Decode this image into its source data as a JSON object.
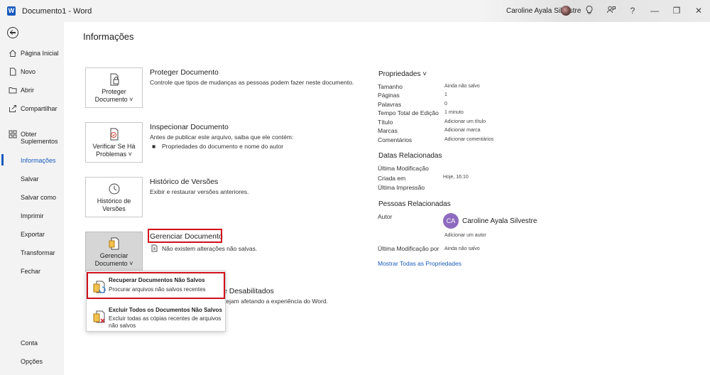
{
  "titlebar": {
    "app_icon": "W",
    "doc_title": "Documento1  -  Word",
    "user_name": "Caroline Ayala Silvestre",
    "icons": [
      "lightbulb-icon",
      "people-icon",
      "help-icon",
      "minimize-icon",
      "restore-icon",
      "close-icon"
    ],
    "help_glyph": "?",
    "minimize_glyph": "—",
    "restore_glyph": "❐",
    "close_glyph": "✕",
    "bulb_glyph": "💡",
    "people_glyph": "⚑"
  },
  "sidebar": {
    "items": [
      {
        "label": "Página Inicial",
        "icon": "home-icon"
      },
      {
        "label": "Novo",
        "icon": "new-doc-icon"
      },
      {
        "label": "Abrir",
        "icon": "folder-icon"
      },
      {
        "label": "Compartilhar",
        "icon": "share-icon"
      },
      {
        "label": "Obter",
        "label2": "Suplementos",
        "icon": "addins-icon"
      },
      {
        "label": "Informações",
        "active": true
      },
      {
        "label": "Salvar"
      },
      {
        "label": "Salvar como"
      },
      {
        "label": "Imprimir"
      },
      {
        "label": "Exportar"
      },
      {
        "label": "Transformar"
      },
      {
        "label": "Fechar"
      }
    ],
    "footer": [
      {
        "label": "Conta"
      },
      {
        "label": "Opções"
      }
    ]
  },
  "main": {
    "title": "Informações",
    "sections": [
      {
        "button_line1": "Proteger",
        "button_line2": "Documento ˅",
        "title": "Proteger Documento",
        "desc": "Controle que tipos de mudanças as pessoas podem fazer neste documento."
      },
      {
        "button_line1": "Verificar Se Há",
        "button_line2": "Problemas ˅",
        "title": "Inspecionar Documento",
        "desc": "Antes de publicar este arquivo, saiba que ele contém:",
        "bullet": "Propriedades do documento e nome do autor"
      },
      {
        "button_line1": "Histórico de",
        "button_line2": "Versões",
        "title": "Histórico de Versões",
        "desc": "Exibir e restaurar versões anteriores."
      },
      {
        "button_line1": "Gerenciar",
        "button_line2": "Documento ˅",
        "title": "Gerenciar Documento",
        "desc": "Não existem alterações não salvas."
      }
    ],
    "partial_section": {
      "title_fragment": "os e Desabilitados",
      "desc_fragment": "e estejam afetando a experiência do Word."
    }
  },
  "dropdown": {
    "items": [
      {
        "title": "Recuperar Documentos Não Salvos",
        "desc": "Procurar arquivos não salvos recentes"
      },
      {
        "title": "Excluir Todos os Documentos Não Salvos",
        "desc": "Excluir todas as cópias recentes de arquivos não salvos"
      }
    ]
  },
  "properties": {
    "header": "Propriedades ˅",
    "rows": [
      {
        "label": "Tamanho",
        "value": "Ainda não salvo"
      },
      {
        "label": "Páginas",
        "value": "1"
      },
      {
        "label": "Palavras",
        "value": "0"
      },
      {
        "label": "Tempo Total de Edição",
        "value": "1 minuto"
      },
      {
        "label": "Título",
        "value": "Adicionar um título"
      },
      {
        "label": "Marcas",
        "value": "Adicionar marca"
      },
      {
        "label": "Comentários",
        "value": "Adicionar comentários"
      }
    ],
    "dates_header": "Datas Relacionadas",
    "dates": [
      {
        "label": "Última Modificação",
        "value": ""
      },
      {
        "label": "Criada em",
        "value": "Hoje, 16:10"
      },
      {
        "label": "Última Impressão",
        "value": ""
      }
    ],
    "people_header": "Pessoas Relacionadas",
    "author_label": "Autor",
    "author_initials": "CA",
    "author_name": "Caroline Ayala Silvestre",
    "add_author": "Adicionar um autor",
    "last_modified_by_label": "Última Modificação por",
    "last_modified_by_value": "Ainda não salvo",
    "show_all": "Mostrar Todas as Propriedades"
  },
  "colors": {
    "accent": "#185abd",
    "highlight": "#d0101b",
    "sidebar_bg": "#f3f3f3"
  }
}
